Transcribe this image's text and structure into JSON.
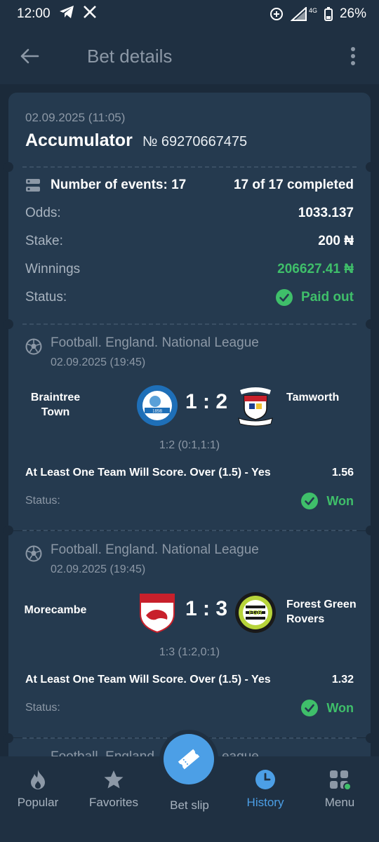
{
  "status_bar": {
    "time": "12:00",
    "battery": "26%",
    "network": "4G"
  },
  "header": {
    "title": "Bet details"
  },
  "bet": {
    "date": "02.09.2025 (11:05)",
    "type": "Accumulator",
    "number": "№ 69270667475",
    "events_label": "Number of events: 17",
    "completed": "17 of 17 completed",
    "odds_label": "Odds:",
    "odds_value": "1033.137",
    "stake_label": "Stake:",
    "stake_value": "200 ₦",
    "winnings_label": "Winnings",
    "winnings_value": "206627.41 ₦",
    "status_label": "Status:",
    "status_value": "Paid out"
  },
  "events": [
    {
      "league": "Football. England. National League",
      "date": "02.09.2025 (19:45)",
      "home": "Braintree Town",
      "away": "Tamworth",
      "score": "1 : 2",
      "detail": "1:2 (0:1,1:1)",
      "market": "At Least One Team Will Score. Over (1.5) - Yes",
      "odd": "1.56",
      "status_label": "Status:",
      "status": "Won"
    },
    {
      "league": "Football. England. National League",
      "date": "02.09.2025 (19:45)",
      "home": "Morecambe",
      "away": "Forest Green Rovers",
      "score": "1 : 3",
      "detail": "1:3 (1:2,0:1)",
      "market": "At Least One Team Will Score. Over (1.5) - Yes",
      "odd": "1.32",
      "status_label": "Status:",
      "status": "Won"
    }
  ],
  "peek_league": "Football. England. National League",
  "nav": [
    {
      "label": "Popular",
      "icon": "flame-icon"
    },
    {
      "label": "Favorites",
      "icon": "star-icon"
    },
    {
      "label": "Bet slip",
      "icon": "ticket-icon"
    },
    {
      "label": "History",
      "icon": "clock-icon"
    },
    {
      "label": "Menu",
      "icon": "grid-icon"
    }
  ],
  "colors": {
    "background": "#1b2a3a",
    "card": "#253a4f",
    "accent": "#4c9fe6",
    "success": "#3fbf6a"
  },
  "logos": {
    "braintree": [
      "BRAINTREE TOWN F.C.",
      "1898",
      "THE IRON"
    ],
    "tamworth": [
      "TAMWORTH",
      "FOOTBALL CLUB"
    ],
    "morecambe": [
      "MORECAMBE FC"
    ],
    "fgr": [
      "FOREST GREEN ROVERS",
      "FGR",
      "FOOTBALL CLUB"
    ]
  }
}
